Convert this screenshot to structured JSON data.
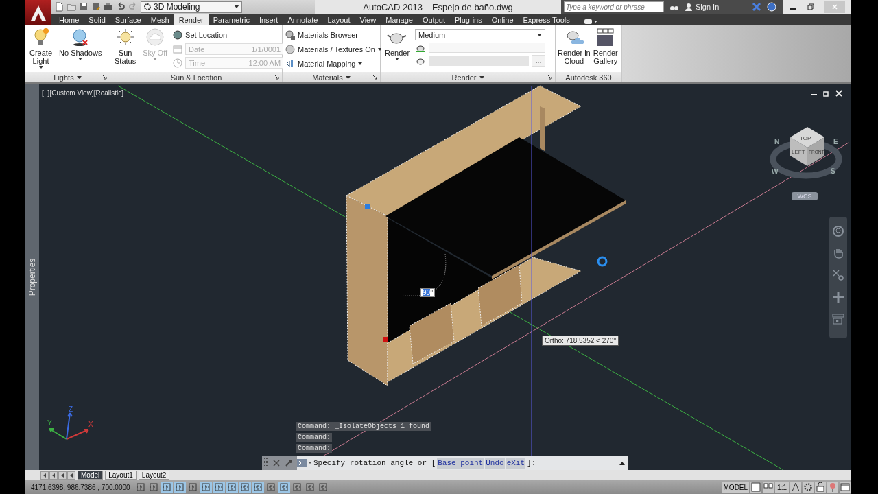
{
  "title_bar": {
    "workspace": "3D Modeling",
    "app_name": "AutoCAD 2013",
    "file_name": "Espejo de baño.dwg",
    "search": {
      "placeholder": "Type a keyword or phrase"
    },
    "sign_in": "Sign In"
  },
  "tabs": [
    {
      "label": "Home",
      "selected": false
    },
    {
      "label": "Solid",
      "selected": false
    },
    {
      "label": "Surface",
      "selected": false
    },
    {
      "label": "Mesh",
      "selected": false
    },
    {
      "label": "Render",
      "selected": true
    },
    {
      "label": "Parametric",
      "selected": false
    },
    {
      "label": "Insert",
      "selected": false
    },
    {
      "label": "Annotate",
      "selected": false
    },
    {
      "label": "Layout",
      "selected": false
    },
    {
      "label": "View",
      "selected": false
    },
    {
      "label": "Manage",
      "selected": false
    },
    {
      "label": "Output",
      "selected": false
    },
    {
      "label": "Plug-ins",
      "selected": false
    },
    {
      "label": "Online",
      "selected": false
    },
    {
      "label": "Express Tools",
      "selected": false
    }
  ],
  "ribbon": {
    "lights": {
      "title": "Lights",
      "buttons": [
        {
          "label": "Create\nLight",
          "dropdown": true
        },
        {
          "label": "No Shadows",
          "dropdown": true
        }
      ]
    },
    "sun_location": {
      "title": "Sun & Location",
      "buttons": [
        {
          "label": "Sun\nStatus",
          "disabled": false
        },
        {
          "label": "Sky Off",
          "disabled": true
        }
      ],
      "set_location": "Set Location",
      "fields": [
        {
          "label": "Date",
          "value": "1/1/0001",
          "disabled": true
        },
        {
          "label": "Time",
          "value": "12:00 AM",
          "disabled": true
        }
      ]
    },
    "materials": {
      "title": "Materials",
      "items": [
        {
          "label": "Materials Browser",
          "dropdown": false
        },
        {
          "label": "Materials / Textures On",
          "dropdown": true
        },
        {
          "label": "Material Mapping",
          "dropdown": true
        }
      ]
    },
    "render": {
      "title": "Render",
      "button": "Render",
      "preset": "Medium",
      "more": "..."
    },
    "autodesk_360": {
      "title": "Autodesk 360",
      "buttons": [
        {
          "label": "Render in\nCloud"
        },
        {
          "label": "Render\nGallery"
        }
      ]
    }
  },
  "viewport": {
    "label": "[−][Custom View][Realistic]",
    "sidebar": "Properties",
    "angle_input": {
      "value": "90",
      "unit": "°"
    },
    "tooltip": "Ortho: 718.5352 < 270°",
    "axes": [
      "Y",
      "Z",
      "X"
    ],
    "viewcube": {
      "faces": [
        "TOP",
        "LEFT",
        "FRONT"
      ],
      "compass": [
        "N",
        "E",
        "W",
        "S"
      ]
    },
    "ucs_menu": "WCS"
  },
  "command": {
    "history": [
      "Command: _IsolateObjects 1 found",
      "Command:",
      "Command:"
    ],
    "prompt": "Specify rotation angle or [",
    "options": [
      "Base point",
      "Undo",
      "eXit"
    ],
    "prompt_end": "]:"
  },
  "layout_tabs": [
    {
      "label": "Model",
      "selected": true
    },
    {
      "label": "Layout1",
      "selected": false
    },
    {
      "label": "Layout2",
      "selected": false
    }
  ],
  "status_bar": {
    "coordinates": "4171.6398, 986.7386 , 700.0000",
    "toggles": [
      {
        "on": false
      },
      {
        "on": false
      },
      {
        "on": true
      },
      {
        "on": true
      },
      {
        "on": false
      },
      {
        "on": true
      },
      {
        "on": true
      },
      {
        "on": true
      },
      {
        "on": true
      },
      {
        "on": true
      },
      {
        "on": false
      },
      {
        "on": true
      },
      {
        "on": false
      },
      {
        "on": false
      },
      {
        "on": false
      }
    ],
    "space": "MODEL",
    "scale": "1:1"
  }
}
